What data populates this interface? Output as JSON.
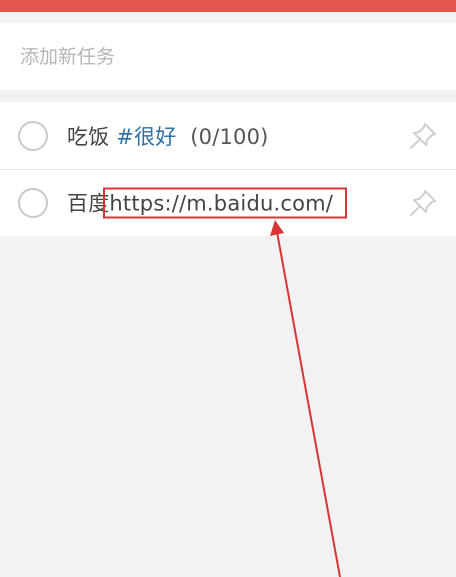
{
  "header": {
    "accent_color": "#e2574c"
  },
  "add_task": {
    "placeholder": "添加新任务"
  },
  "tasks": [
    {
      "title": "吃饭",
      "tag": "#很好",
      "progress": "(0/100)",
      "icon": "pin-icon"
    },
    {
      "title": "百度",
      "url": "https://m.baidu.com/",
      "icon": "pin-icon"
    }
  ],
  "annotation": {
    "color": "#d93434"
  }
}
